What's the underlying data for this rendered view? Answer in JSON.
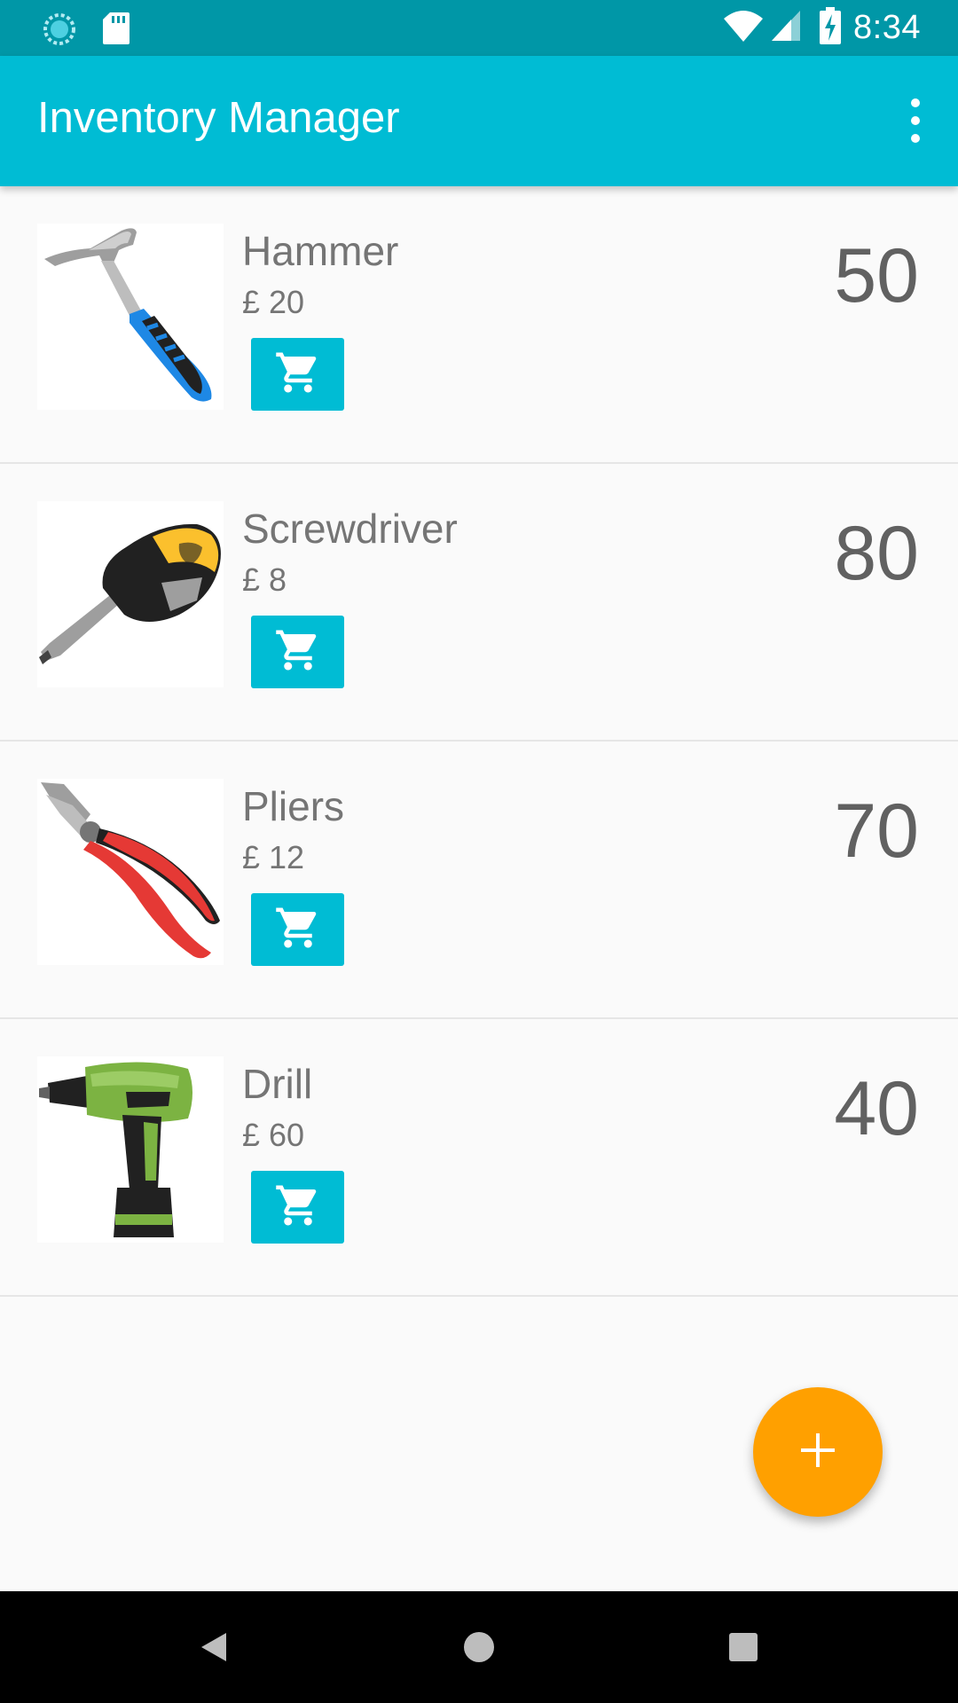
{
  "status_bar": {
    "time": "8:34",
    "icons": [
      "sync-icon",
      "sd-card-icon",
      "wifi-icon",
      "signal-icon",
      "battery-charging-icon"
    ]
  },
  "app_bar": {
    "title": "Inventory Manager",
    "menu_icon": "more-vert-icon"
  },
  "products": [
    {
      "name": "Hammer",
      "price": "£ 20",
      "quantity": "50",
      "image": "hammer"
    },
    {
      "name": "Screwdriver",
      "price": "£ 8",
      "quantity": "80",
      "image": "screwdriver"
    },
    {
      "name": "Pliers",
      "price": "£ 12",
      "quantity": "70",
      "image": "pliers"
    },
    {
      "name": "Drill",
      "price": "£ 60",
      "quantity": "40",
      "image": "drill"
    }
  ],
  "fab": {
    "icon": "add-icon"
  },
  "nav_bar": {
    "icons": [
      "back-icon",
      "home-icon",
      "recents-icon"
    ]
  },
  "colors": {
    "primary": "#00bcd4",
    "primary_dark": "#0097a7",
    "accent": "#ffa000",
    "text": "#757575"
  }
}
